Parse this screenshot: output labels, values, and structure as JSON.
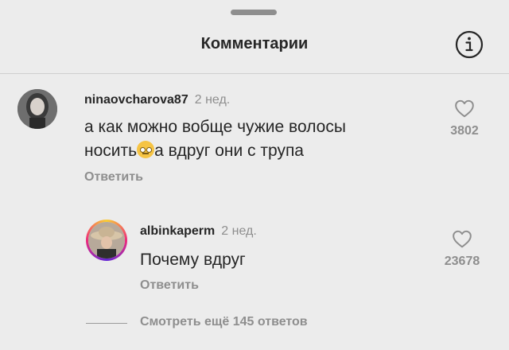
{
  "header": {
    "title": "Комментарии"
  },
  "comments": [
    {
      "username": "ninaovcharova87",
      "time": "2 нед.",
      "text_part1": "а как можно вобще чужие волосы",
      "text_part2": "носить",
      "text_part3": "а вдруг они с трупа",
      "reply_label": "Ответить",
      "likes": "3802"
    }
  ],
  "reply": {
    "username": "albinkaperm",
    "time": "2 нед.",
    "text": "Почему вдруг",
    "reply_label": "Ответить",
    "likes": "23678"
  },
  "view_more": "Смотреть ещё 145 ответов",
  "colors": {
    "background": "#ececec",
    "muted": "#8e8e8e",
    "text": "#262626"
  }
}
